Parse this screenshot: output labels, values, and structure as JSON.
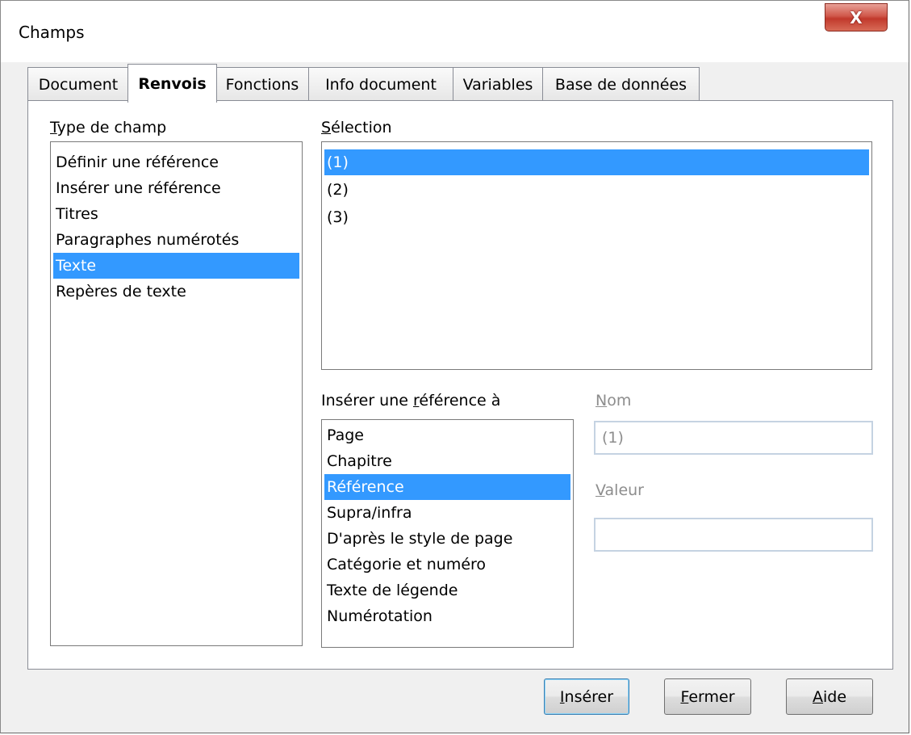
{
  "window": {
    "title": "Champs",
    "close_label": "X"
  },
  "tabs": [
    {
      "label": "Document",
      "active": false
    },
    {
      "label": "Renvois",
      "active": true
    },
    {
      "label": "Fonctions",
      "active": false
    },
    {
      "label": "Info document",
      "active": false
    },
    {
      "label": "Variables",
      "active": false
    },
    {
      "label": "Base de données",
      "active": false
    }
  ],
  "type_de_champ": {
    "label_mnemonic": "T",
    "label_rest": "ype de champ",
    "items": [
      "Définir une référence",
      "Insérer une référence",
      "Titres",
      "Paragraphes numérotés",
      "Texte",
      "Repères de texte"
    ],
    "selected": "Texte"
  },
  "selection": {
    "label_mnemonic": "S",
    "label_rest": "élection",
    "items": [
      "(1)",
      "(2)",
      "(3)"
    ],
    "selected": "(1)"
  },
  "inserer_reference": {
    "label_before": "Insérer une ",
    "label_mnemonic": "r",
    "label_after": "éférence à",
    "items": [
      "Page",
      "Chapitre",
      "Référence",
      "Supra/infra",
      "D'après le style de page",
      "Catégorie et numéro",
      "Texte de légende",
      "Numérotation"
    ],
    "selected": "Référence"
  },
  "nom": {
    "label_mnemonic": "N",
    "label_rest": "om",
    "value": "(1)"
  },
  "valeur": {
    "label_mnemonic": "V",
    "label_rest": "aleur",
    "value": ""
  },
  "buttons": {
    "insert_mnemonic": "I",
    "insert_rest": "nsérer",
    "close_mnemonic": "F",
    "close_rest": "ermer",
    "help_mnemonic": "A",
    "help_rest": "ide"
  },
  "colors": {
    "selection": "#3399ff",
    "window_bg": "#f0f0f0",
    "close_button": "#c1392c"
  }
}
